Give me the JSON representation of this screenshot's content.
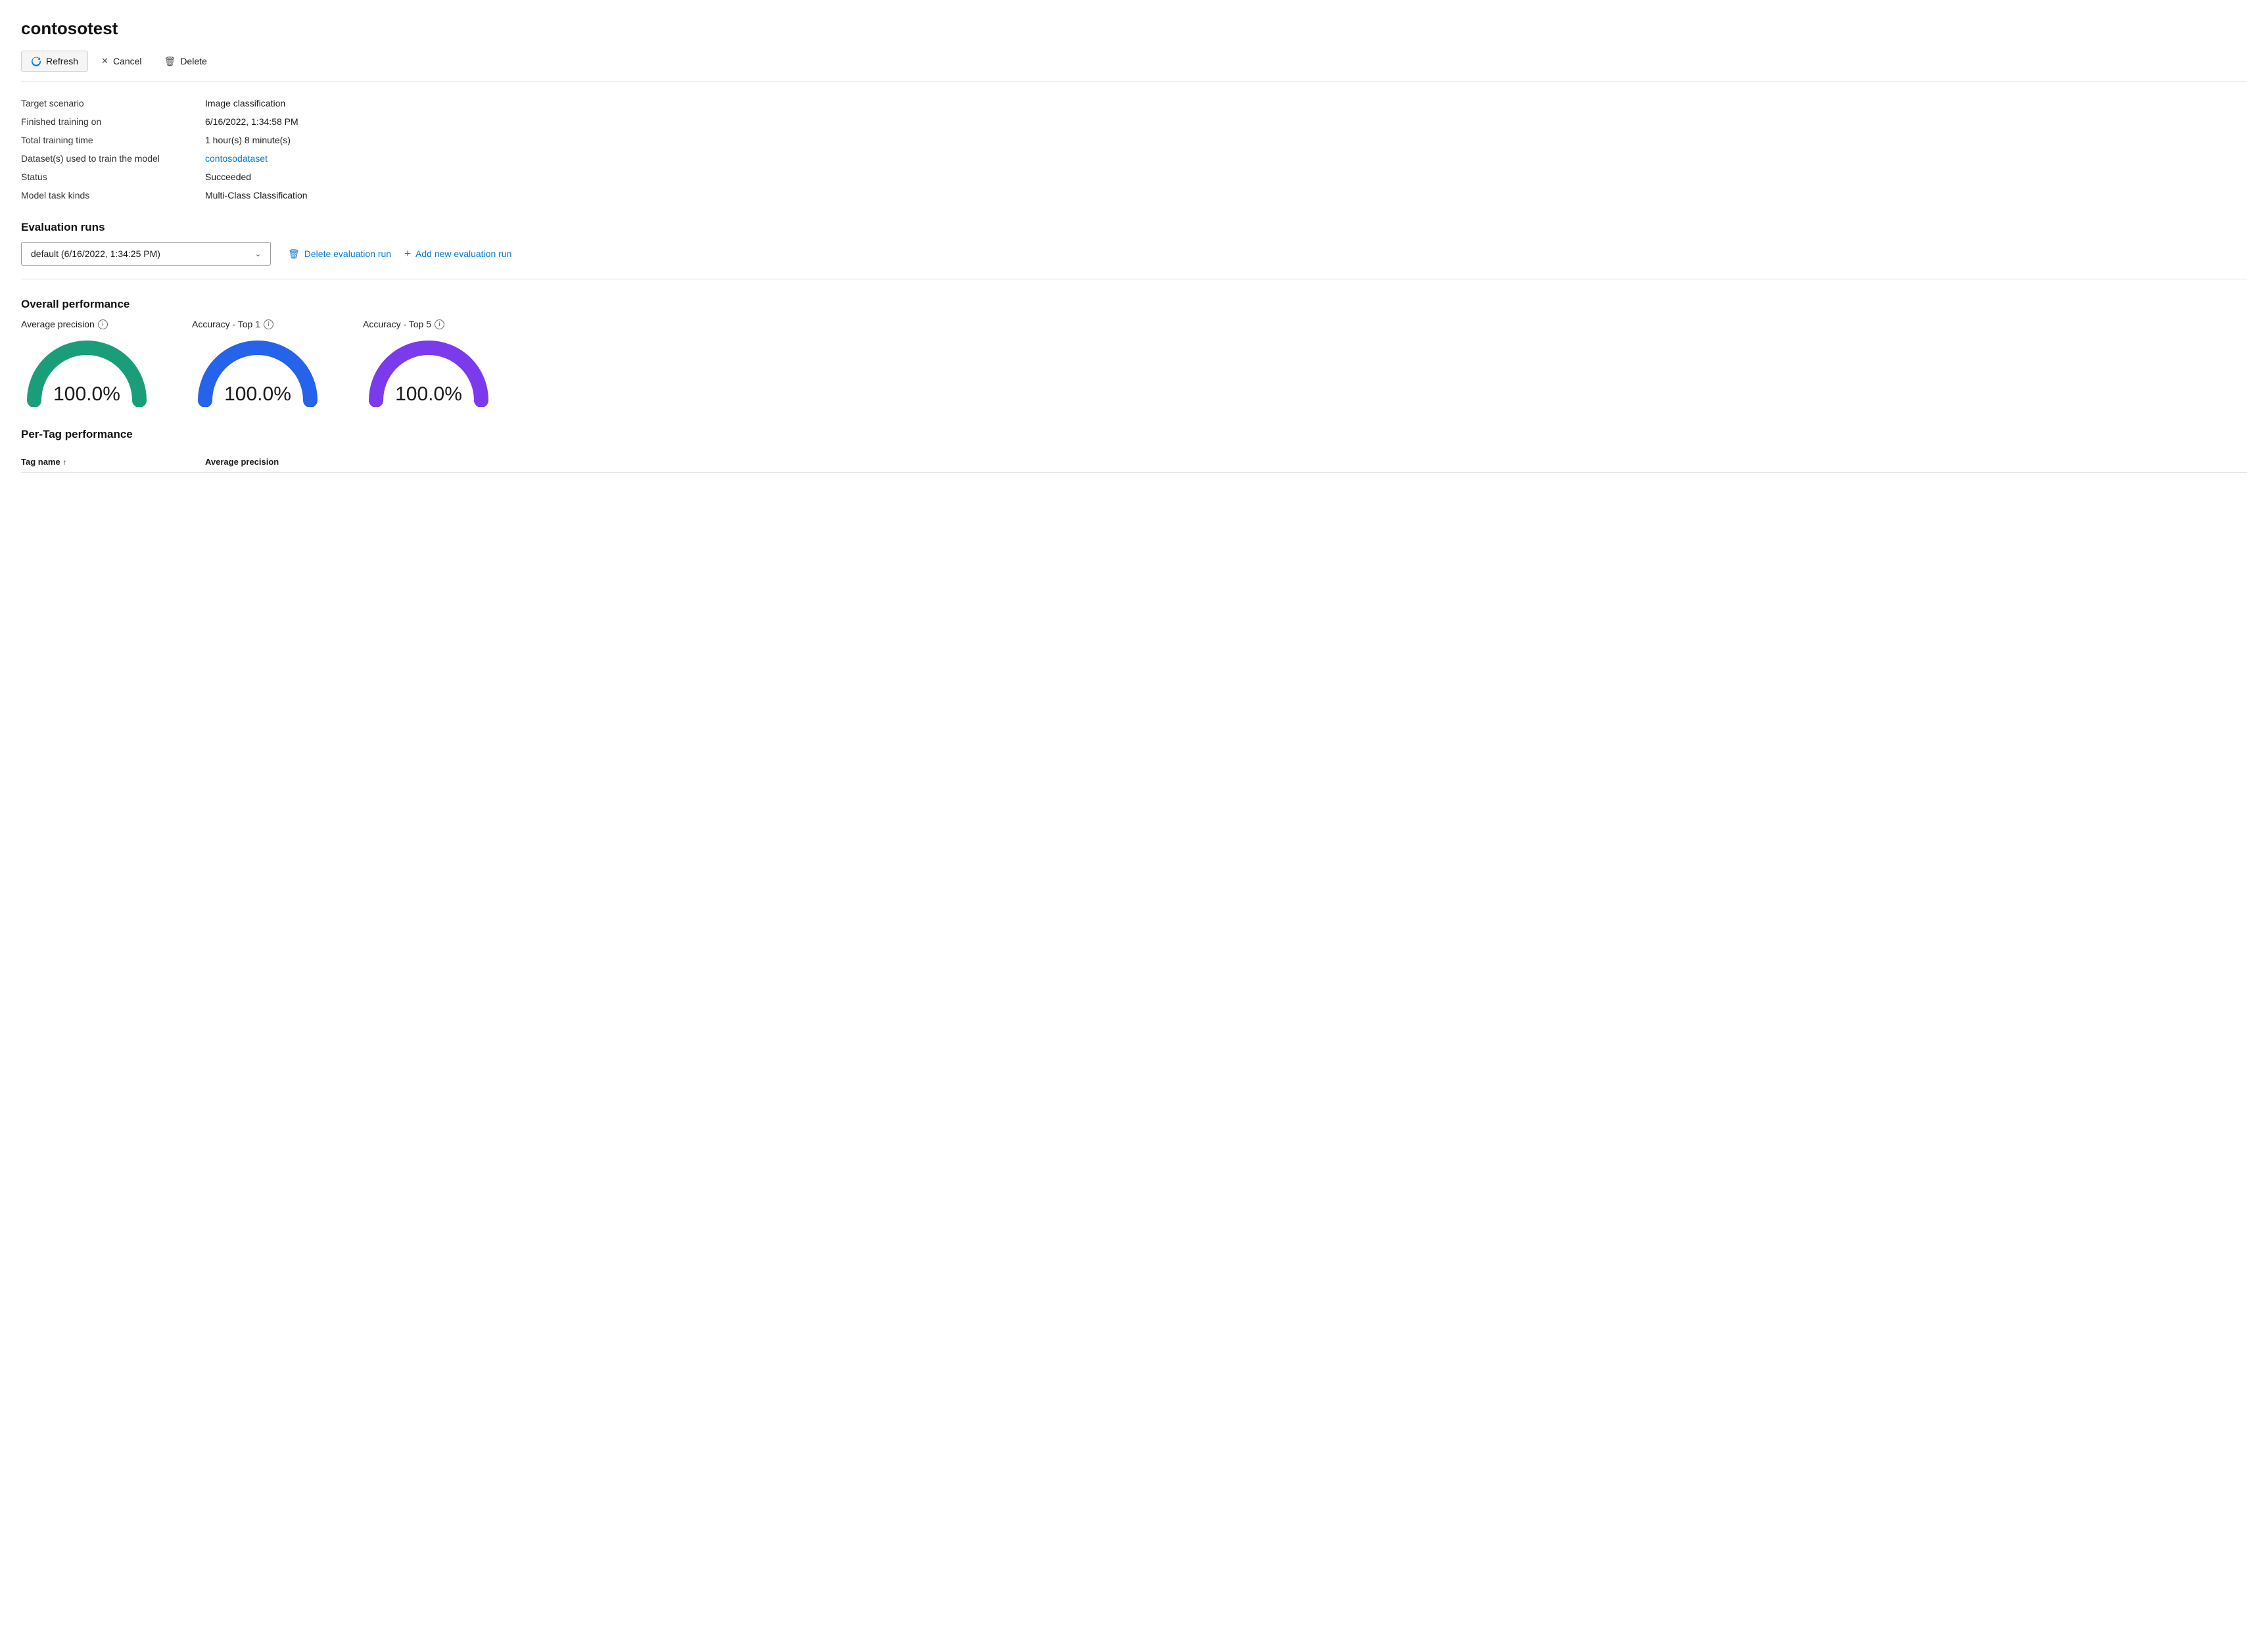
{
  "page": {
    "title": "contosotest"
  },
  "toolbar": {
    "refresh_label": "Refresh",
    "cancel_label": "Cancel",
    "delete_label": "Delete"
  },
  "info": {
    "rows": [
      {
        "label": "Target scenario",
        "value": "Image classification",
        "type": "text"
      },
      {
        "label": "Finished training on",
        "value": "6/16/2022, 1:34:58 PM",
        "type": "text"
      },
      {
        "label": "Total training time",
        "value": "1 hour(s) 8 minute(s)",
        "type": "text"
      },
      {
        "label": "Dataset(s) used to train the model",
        "value": "contosodataset",
        "type": "link"
      },
      {
        "label": "Status",
        "value": "Succeeded",
        "type": "text"
      },
      {
        "label": "Model task kinds",
        "value": "Multi-Class Classification",
        "type": "text"
      }
    ]
  },
  "evaluation_runs": {
    "section_title": "Evaluation runs",
    "dropdown_value": "default (6/16/2022, 1:34:25 PM)",
    "delete_label": "Delete evaluation run",
    "add_label": "Add new evaluation run"
  },
  "overall_performance": {
    "section_title": "Overall performance",
    "gauges": [
      {
        "label": "Average precision",
        "value": "100.0%",
        "color": "#1a9e7a"
      },
      {
        "label": "Accuracy - Top 1",
        "value": "100.0%",
        "color": "#2563eb"
      },
      {
        "label": "Accuracy - Top 5",
        "value": "100.0%",
        "color": "#7c3aed"
      }
    ]
  },
  "per_tag_performance": {
    "section_title": "Per-Tag performance",
    "columns": [
      {
        "label": "Tag name",
        "sortable": true,
        "sort_dir": "asc"
      },
      {
        "label": "Average precision",
        "sortable": false
      }
    ]
  },
  "icons": {
    "info": "i",
    "sort_asc": "↑",
    "chevron_down": "⌄",
    "plus": "+",
    "trash": "🗑",
    "refresh": "↻",
    "cancel_x": "✕"
  }
}
